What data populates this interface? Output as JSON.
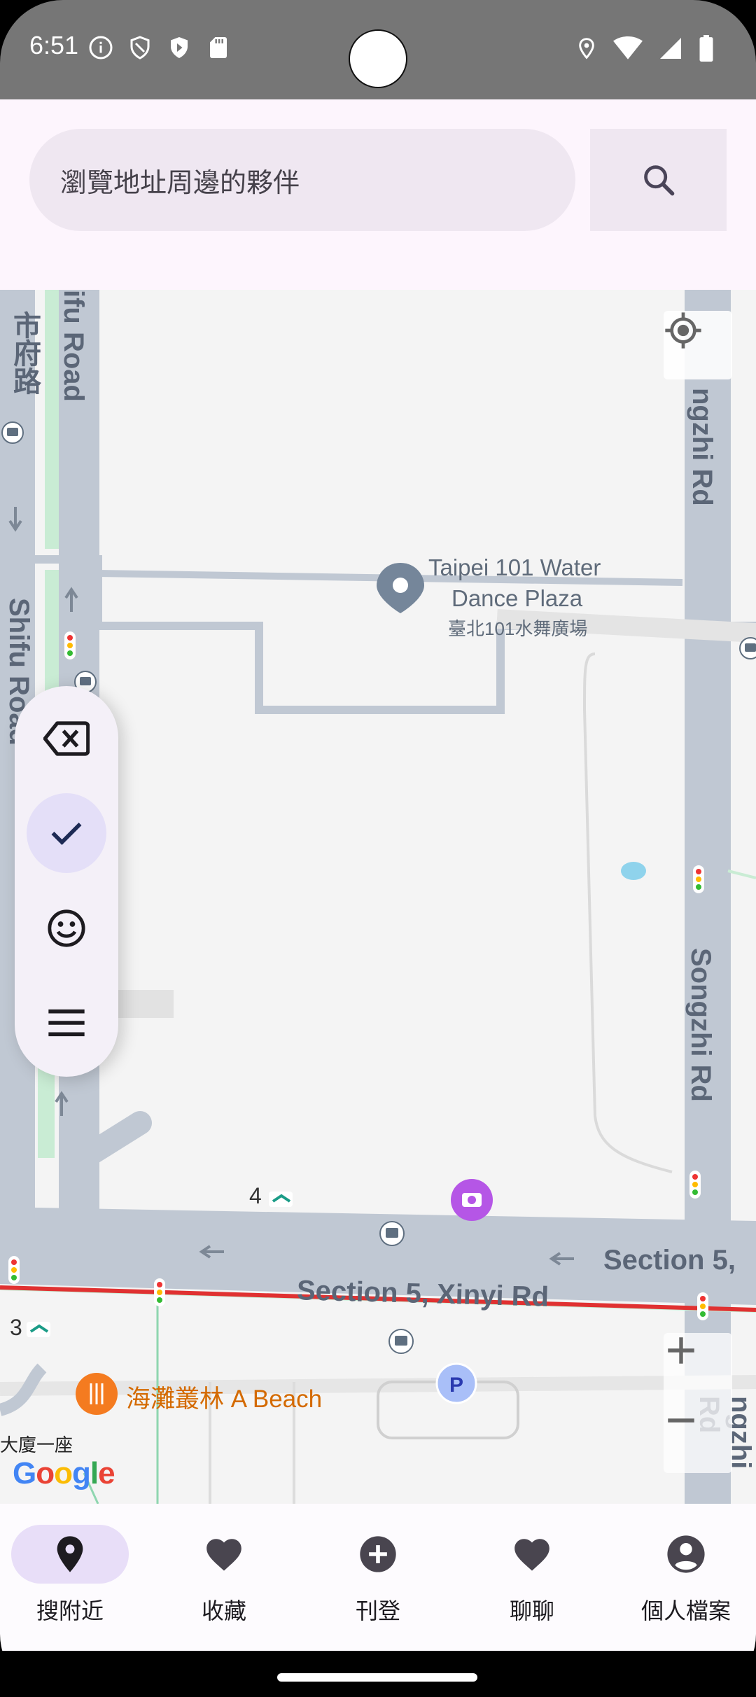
{
  "status_bar": {
    "time": "6:51"
  },
  "search": {
    "placeholder": "瀏覽地址周邊的夥伴"
  },
  "map": {
    "labels": {
      "shifu_road_top": "ifu Road",
      "shifu_road_zh": "市府路",
      "shifu_road_left": "Shifu Road",
      "songzhi_top": "ngzhi Rd",
      "songzhi_mid": "Songzhi Rd",
      "songzhi_bottom": "ngzhi Rd",
      "plaza_en_line1": "Taipei 101 Water",
      "plaza_en_line2": "Dance Plaza",
      "plaza_zh": "臺北101水舞廣場",
      "xinyi_rd": "Section 5, Xinyi Rd",
      "section5_right": "Section 5, ",
      "station_4": "4",
      "station_3": "3",
      "beach": "海灘叢林 A Beach",
      "building": "大廈一座",
      "google": "Google"
    },
    "colors": {
      "road": "#c0c8d3",
      "park": "#c9ecd4",
      "beach_text": "#d46a00",
      "red_line": "#e03131"
    }
  },
  "toolbar": {
    "icons": [
      "backspace-icon",
      "check-icon",
      "emoji-icon",
      "menu-icon"
    ],
    "selected": "check-icon"
  },
  "nav": {
    "items": [
      {
        "label": "搜附近",
        "icon": "location-pin-icon",
        "active": true
      },
      {
        "label": "收藏",
        "icon": "heart-icon",
        "active": false
      },
      {
        "label": "刊登",
        "icon": "add-circle-icon",
        "active": false
      },
      {
        "label": "聊聊",
        "icon": "heart-icon",
        "active": false
      },
      {
        "label": "個人檔案",
        "icon": "account-icon",
        "active": false
      }
    ],
    "active_color": "#e8def8"
  }
}
